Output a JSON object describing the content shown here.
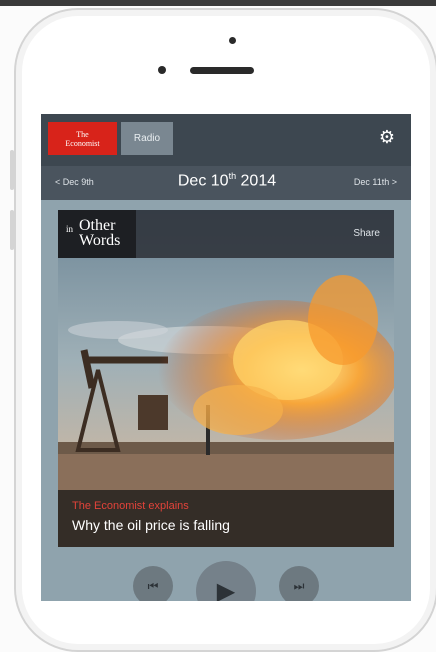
{
  "app": {
    "logo_line1": "The",
    "logo_line2": "Economist",
    "tab_radio": "Radio",
    "settings_icon": "gear-icon"
  },
  "date_nav": {
    "prev": "< Dec 9th",
    "current_main": "Dec 10",
    "current_sup": "th",
    "current_year": " 2014",
    "next": "Dec 11th >"
  },
  "card": {
    "brand_small": "in",
    "brand_line1": "Other",
    "brand_line2": "Words",
    "share": "Share",
    "kicker": "The Economist explains",
    "headline": "Why the oil price is falling"
  },
  "player": {
    "prev_icon": "skip-back-icon",
    "play_icon": "play-icon",
    "next_icon": "skip-forward-icon"
  }
}
